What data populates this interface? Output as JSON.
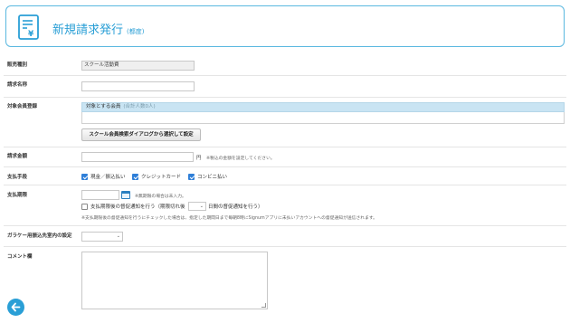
{
  "header": {
    "title": "新規請求発行",
    "subtitle": "(都度)",
    "icon": "invoice-yen-icon"
  },
  "form": {
    "sales_type": {
      "label": "販売種別",
      "value": "スクール活動費"
    },
    "billing_name": {
      "label": "請求名称",
      "value": ""
    },
    "members": {
      "label": "対象会員登録",
      "header": "対象とする会員",
      "count_note": "(合計人数0人)",
      "select_button": "スクール会員検索ダイアログから選択して設定"
    },
    "amount": {
      "label": "請求金額",
      "value": "",
      "unit": "円",
      "note": "※税込の金額を設定してください。"
    },
    "payment_method": {
      "label": "支払手段",
      "options": [
        {
          "label": "現金／振込払い",
          "checked": true
        },
        {
          "label": "クレジットカード",
          "checked": true
        },
        {
          "label": "コンビニ払い",
          "checked": true
        }
      ]
    },
    "deadline": {
      "label": "支払期限",
      "value": "",
      "note": "※無期限の場合は未入力。",
      "reminder_label": "支払期限後の督促通知を行う（期限切れ後",
      "reminder_select": "",
      "reminder_suffix": "日間の督促通知を行う）",
      "reminder_checked": false,
      "footnote": "※支払期限後の督促通知を行うにチェックした場合は、指定した期間日まで毎朝8時にSignumアプリに未払いアカウントへの督促通知が送信されます。"
    },
    "gakyu": {
      "label": "ガラケー用振込先室内の設定",
      "value": ""
    },
    "comment": {
      "label": "コメント欄",
      "value": ""
    }
  },
  "colors": {
    "accent": "#2a9fd6",
    "checkbox": "#2f7fd8",
    "member_header_bg": "#c9e4f3"
  },
  "back_button": {
    "icon": "arrow-left-icon"
  }
}
